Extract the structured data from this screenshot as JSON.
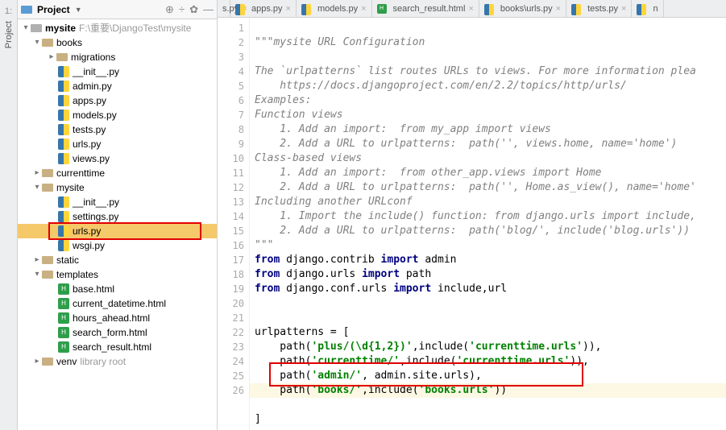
{
  "rail": {
    "num": "1:",
    "label": "Project"
  },
  "panel": {
    "title": "Project",
    "tools": {
      "target": "⊕",
      "split": "÷",
      "gear": "✿",
      "collapse": "—"
    }
  },
  "tree": {
    "root": {
      "label": "mysite",
      "path": "F:\\重要\\DjangoTest\\mysite"
    },
    "books": {
      "label": "books",
      "migrations": "migrations",
      "init": "__init__.py",
      "admin": "admin.py",
      "apps": "apps.py",
      "models": "models.py",
      "tests": "tests.py",
      "urls": "urls.py",
      "views": "views.py"
    },
    "currenttime": "currenttime",
    "mysite": {
      "label": "mysite",
      "init": "__init__.py",
      "settings": "settings.py",
      "urls": "urls.py",
      "wsgi": "wsgi.py"
    },
    "static": "static",
    "templates": {
      "label": "templates",
      "base": "base.html",
      "cdt": "current_datetime.html",
      "ha": "hours_ahead.html",
      "sf": "search_form.html",
      "sr": "search_result.html"
    },
    "venv": {
      "label": "venv",
      "note": "library root"
    }
  },
  "tabs": {
    "cut": "s.py",
    "apps": "apps.py",
    "models": "models.py",
    "search_result": "search_result.html",
    "books_urls": "books\\urls.py",
    "tests": "tests.py",
    "last": "n"
  },
  "code": {
    "l1": "\"\"\"mysite URL Configuration",
    "l2": "",
    "l3": "The `urlpatterns` list routes URLs to views. For more information plea",
    "l4": "    https://docs.djangoproject.com/en/2.2/topics/http/urls/",
    "l5": "Examples:",
    "l6": "Function views",
    "l7": "    1. Add an import:  from my_app import views",
    "l8": "    2. Add a URL to urlpatterns:  path('', views.home, name='home')",
    "l9": "Class-based views",
    "l10": "    1. Add an import:  from other_app.views import Home",
    "l11": "    2. Add a URL to urlpatterns:  path('', Home.as_view(), name='home'",
    "l12": "Including another URLconf",
    "l13": "    1. Import the include() function: from django.urls import include,",
    "l14": "    2. Add a URL to urlpatterns:  path('blog/', include('blog.urls'))",
    "l15": "\"\"\"",
    "l16a": "from",
    "l16b": " django.contrib ",
    "l16c": "import",
    "l16d": " admin",
    "l17a": "from",
    "l17b": " django.urls ",
    "l17c": "import",
    "l17d": " path",
    "l18a": "from",
    "l18b": " django.conf.urls ",
    "l18c": "import",
    "l18d": " include,url",
    "l21": "urlpatterns = [",
    "l22a": "    path(",
    "l22b": "'plus/(\\d{1,2})'",
    "l22c": ",include(",
    "l22d": "'currenttime.urls'",
    "l22e": ")),",
    "l23a": "    path(",
    "l23b": "'currenttime/'",
    "l23c": ",include(",
    "l23d": "'currenttime.urls'",
    "l23e": ")),",
    "l24a": "    path(",
    "l24b": "'admin/'",
    "l24c": ", admin.site.urls),",
    "l25a": "    path(",
    "l25b": "'books/'",
    "l25c": ",include(",
    "l25d": "'books.urls'",
    "l25e": "))",
    "l26": "]"
  }
}
